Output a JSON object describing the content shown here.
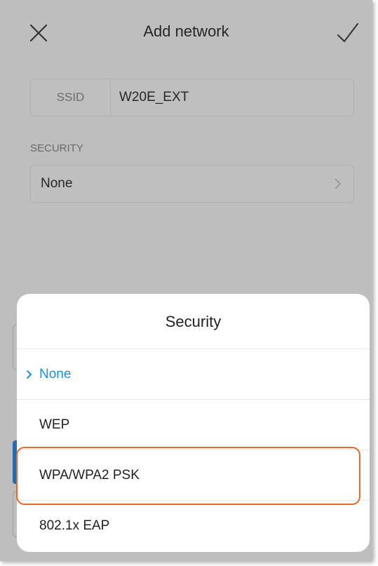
{
  "header": {
    "title": "Add network",
    "close_icon": "close-icon",
    "confirm_icon": "checkmark-icon"
  },
  "form": {
    "ssid_label": "SSID",
    "ssid_value": "W20E_EXT",
    "security_caption": "SECURITY",
    "security_value": "None",
    "chevron_icon": "chevron-right-icon"
  },
  "security_sheet": {
    "title": "Security",
    "options": [
      {
        "label": "None",
        "selected": true
      },
      {
        "label": "WEP",
        "selected": false
      },
      {
        "label": "WPA/WPA2 PSK",
        "selected": false,
        "highlighted": true
      },
      {
        "label": "802.1x EAP",
        "selected": false
      }
    ]
  },
  "colors": {
    "accent": "#1e8fe6",
    "highlight_outline": "#e8692a",
    "text": "#333333",
    "muted": "#8e8e8e"
  }
}
